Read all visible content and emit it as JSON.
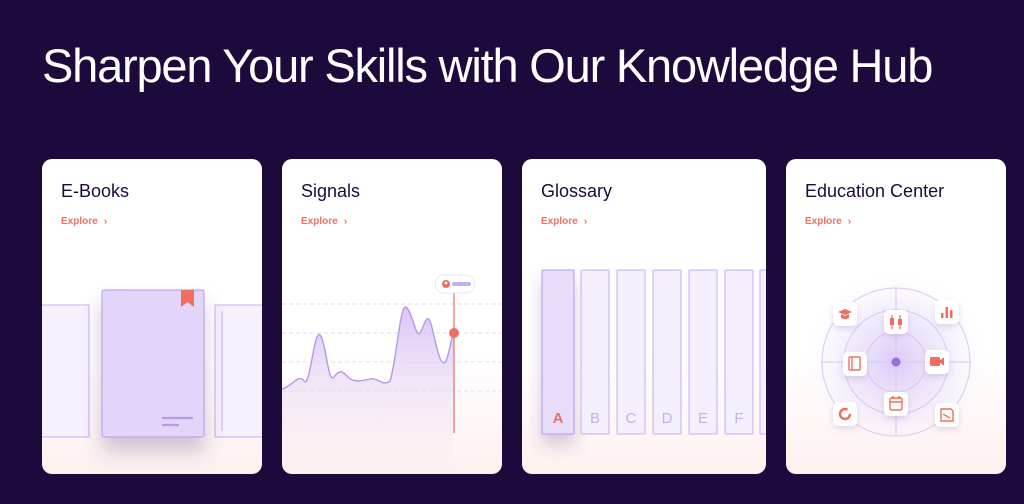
{
  "headline": "Sharpen Your Skills with Our Knowledge Hub",
  "accent_color": "#ef6e5e",
  "background_color": "#1d0a3c",
  "cards": [
    {
      "title": "E-Books",
      "link": "Explore"
    },
    {
      "title": "Signals",
      "link": "Explore"
    },
    {
      "title": "Glossary",
      "link": "Explore",
      "letters": [
        "A",
        "B",
        "C",
        "D",
        "E",
        "F"
      ]
    },
    {
      "title": "Education Center",
      "link": "Explore",
      "icons": [
        "graduation-cap-icon",
        "candlestick-icon",
        "bar-chart-icon",
        "book-icon",
        "video-icon",
        "calendar-icon",
        "donut-chart-icon",
        "document-icon"
      ]
    }
  ]
}
